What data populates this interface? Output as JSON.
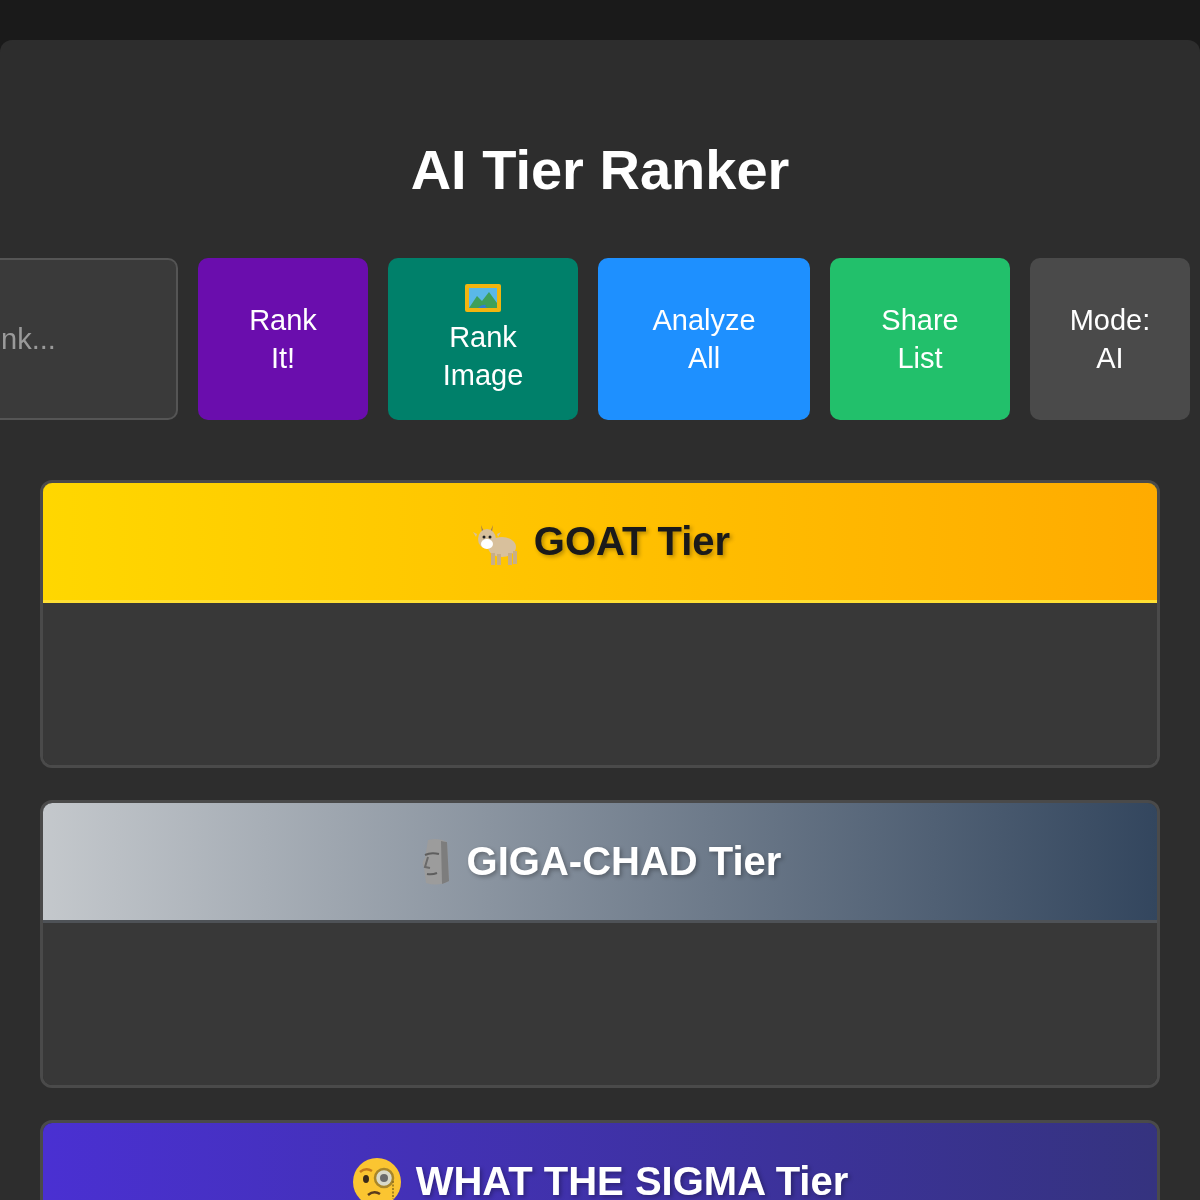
{
  "title": "AI Tier Ranker",
  "controls": {
    "search": {
      "placeholder": "nk..."
    },
    "buttons": [
      {
        "label": "Rank It!",
        "kind": "text",
        "color": "#6a0dad"
      },
      {
        "label": "Rank Image",
        "kind": "icon",
        "color": "#00806a"
      },
      {
        "label": "Analyze All",
        "kind": "text",
        "color": "#1e90ff"
      },
      {
        "label": "Share List",
        "kind": "text",
        "color": "#22c06b"
      },
      {
        "label": "Mode: AI",
        "kind": "text",
        "color": "#4a4a4a"
      }
    ]
  },
  "tiers": [
    {
      "label": "GOAT Tier",
      "kind": "goat"
    },
    {
      "label": "GIGA-CHAD Tier",
      "kind": "chad"
    },
    {
      "label": "WHAT THE SIGMA Tier",
      "kind": "sigma"
    }
  ]
}
